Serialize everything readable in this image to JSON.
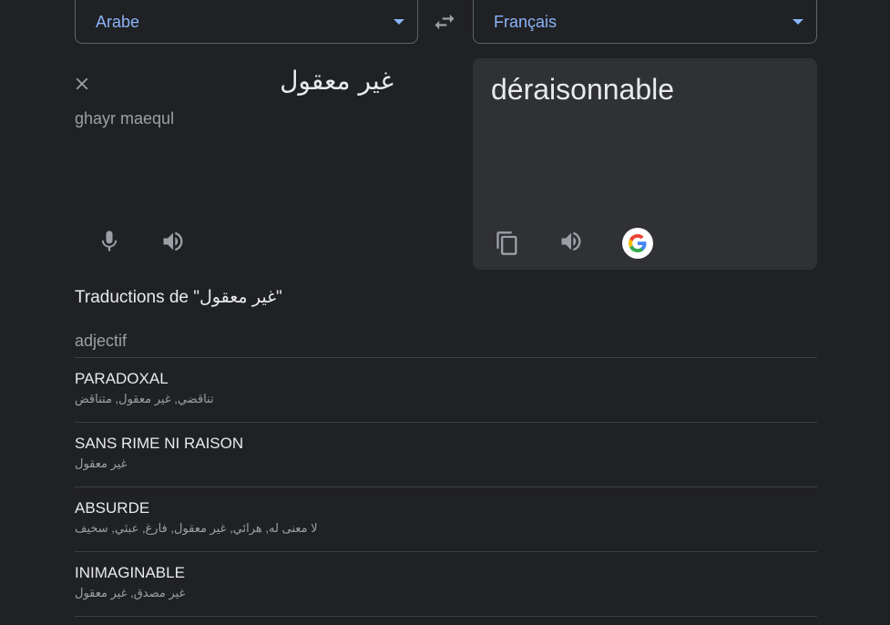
{
  "languages": {
    "source": "Arabe",
    "target": "Français"
  },
  "source": {
    "text": "غير معقول",
    "transliteration": "ghayr maequl"
  },
  "target": {
    "text": "déraisonnable"
  },
  "translations": {
    "title": "Traductions de \"غير معقول\"",
    "part_of_speech": "adjectif",
    "entries": [
      {
        "word": "PARADOXAL",
        "synonyms": "تناقضي, غير معقول, متناقض"
      },
      {
        "word": "SANS RIME NI RAISON",
        "synonyms": "غير معقول"
      },
      {
        "word": "ABSURDE",
        "synonyms": "لا معنى له, هرائي, غير معقول, فارغ, عبثي, سخيف"
      },
      {
        "word": "INIMAGINABLE",
        "synonyms": "غير مصدق, غير معقول"
      }
    ]
  },
  "colors": {
    "background": "#202124",
    "panel": "#303134",
    "accent": "#8ab4f8",
    "text": "#e8eaed",
    "muted": "#9aa0a6"
  },
  "icons": [
    "swap-icon",
    "close-icon",
    "mic-icon",
    "speaker-icon",
    "copy-icon",
    "google-logo-icon"
  ]
}
